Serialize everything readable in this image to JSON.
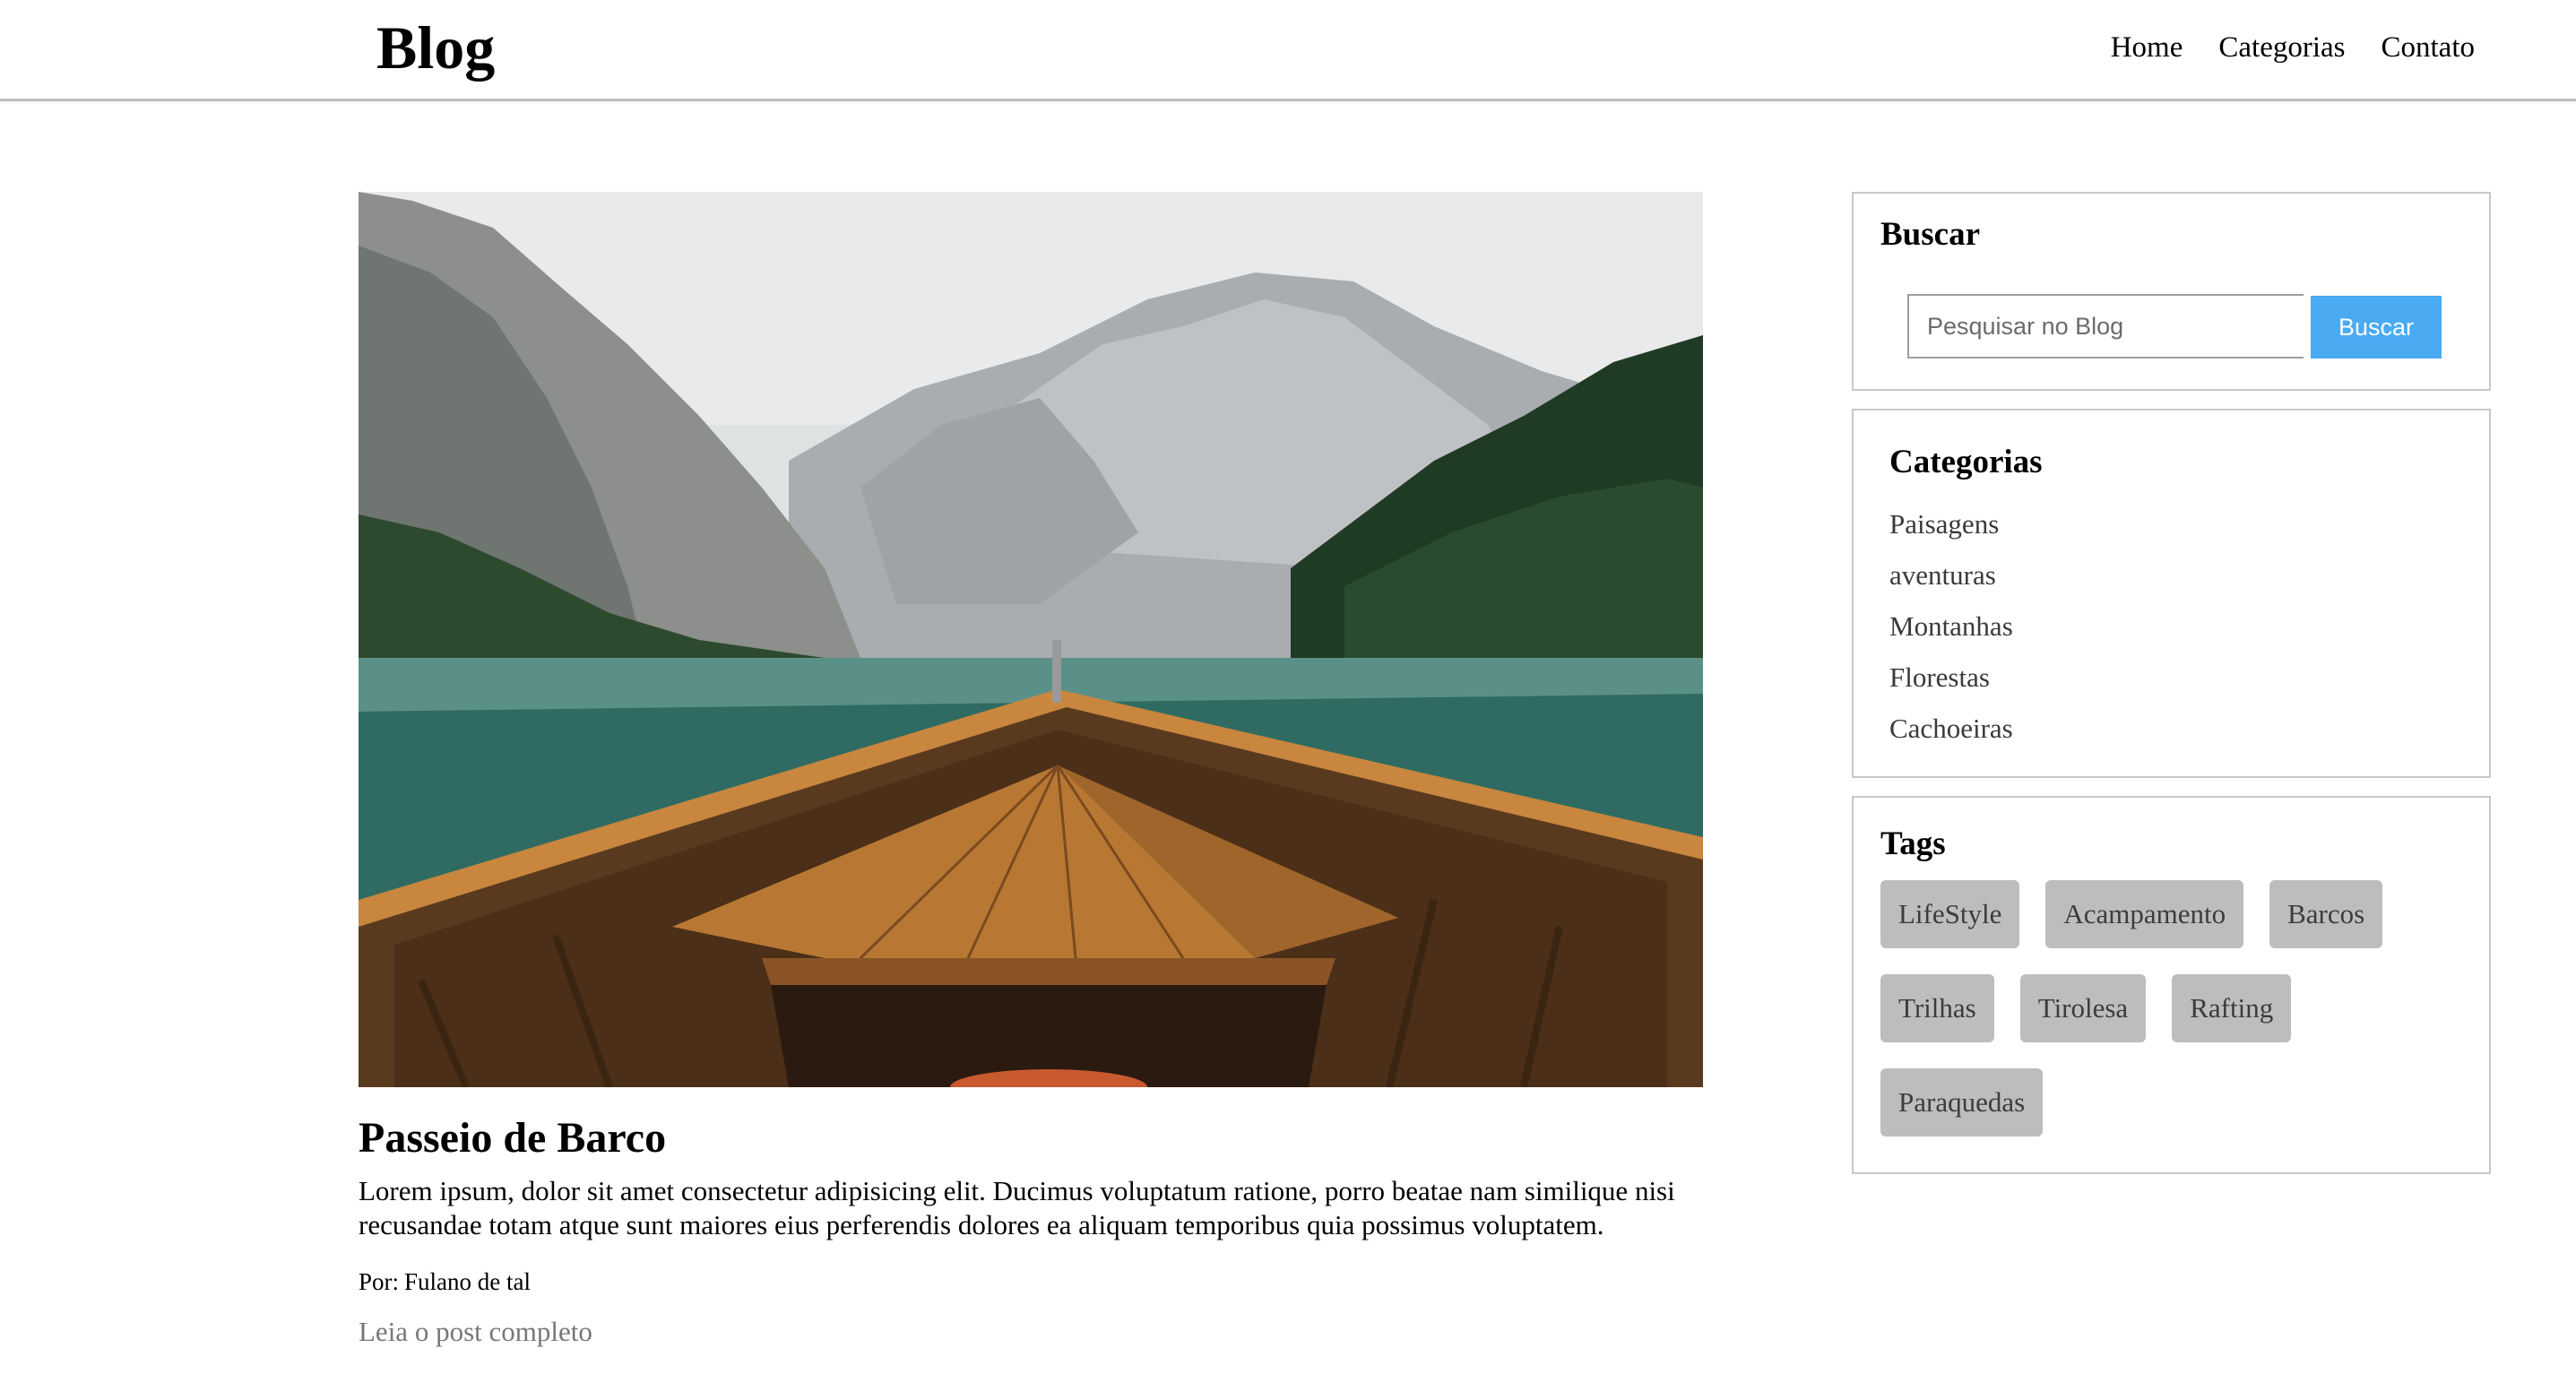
{
  "header": {
    "logo": "Blog",
    "nav": [
      "Home",
      "Categorias",
      "Contato"
    ]
  },
  "post": {
    "image_alt": "Passeio de Barco",
    "title": "Passeio de Barco",
    "excerpt": "Lorem ipsum, dolor sit amet consectetur adipisicing elit. Ducimus voluptatum ratione, porro beatae nam similique nisi recusandae totam atque sunt maiores eius perferendis dolores ea aliquam temporibus quia possimus voluptatem.",
    "author_label": "Por:",
    "author_name": "Fulano de tal",
    "read_more": "Leia o post completo"
  },
  "sidebar": {
    "search": {
      "title": "Buscar",
      "placeholder": "Pesquisar no Blog",
      "button": "Buscar",
      "button_color": "#4aaaf2"
    },
    "categories": {
      "title": "Categorias",
      "items": [
        "Paisagens",
        "aventuras",
        "Montanhas",
        "Florestas",
        "Cachoeiras"
      ]
    },
    "tags": {
      "title": "Tags",
      "items": [
        "LifeStyle",
        "Acampamento",
        "Barcos",
        "Trilhas",
        "Tirolesa",
        "Rafting",
        "Paraquedas"
      ]
    }
  }
}
